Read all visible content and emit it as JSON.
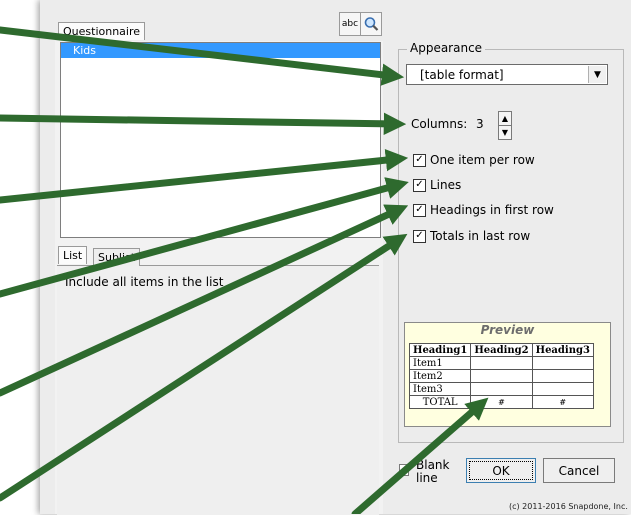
{
  "left": {
    "questionnaire_tab": "Questionnaire",
    "list_items": [
      "Kids"
    ],
    "abc_button": "abc",
    "list_tab": "List",
    "sublist_tab": "Sublist",
    "list_description": "Include all items in the list"
  },
  "appearance": {
    "legend": "Appearance",
    "format_value": "[table format]",
    "columns_label": "Columns:",
    "columns_value": "3",
    "options": [
      {
        "label": "One item per row",
        "checked": true
      },
      {
        "label": "Lines",
        "checked": true
      },
      {
        "label": "Headings in first row",
        "checked": true
      },
      {
        "label": "Totals in last row",
        "checked": true
      }
    ]
  },
  "preview": {
    "title": "Preview",
    "headings": [
      "Heading1",
      "Heading2",
      "Heading3"
    ],
    "rows": [
      "Item1",
      "Item2",
      "Item3"
    ],
    "total_label": "TOTAL",
    "total_marks": [
      "#",
      "#"
    ]
  },
  "footer": {
    "blank_line_label_1": "Blank",
    "blank_line_label_2": "line",
    "ok": "OK",
    "cancel": "Cancel",
    "copyright": "(c) 2011-2016 Snapdone, Inc."
  },
  "colors": {
    "selection": "#3399ff",
    "arrow": "#2e6a2e",
    "preview_bg": "#ffffe0"
  }
}
